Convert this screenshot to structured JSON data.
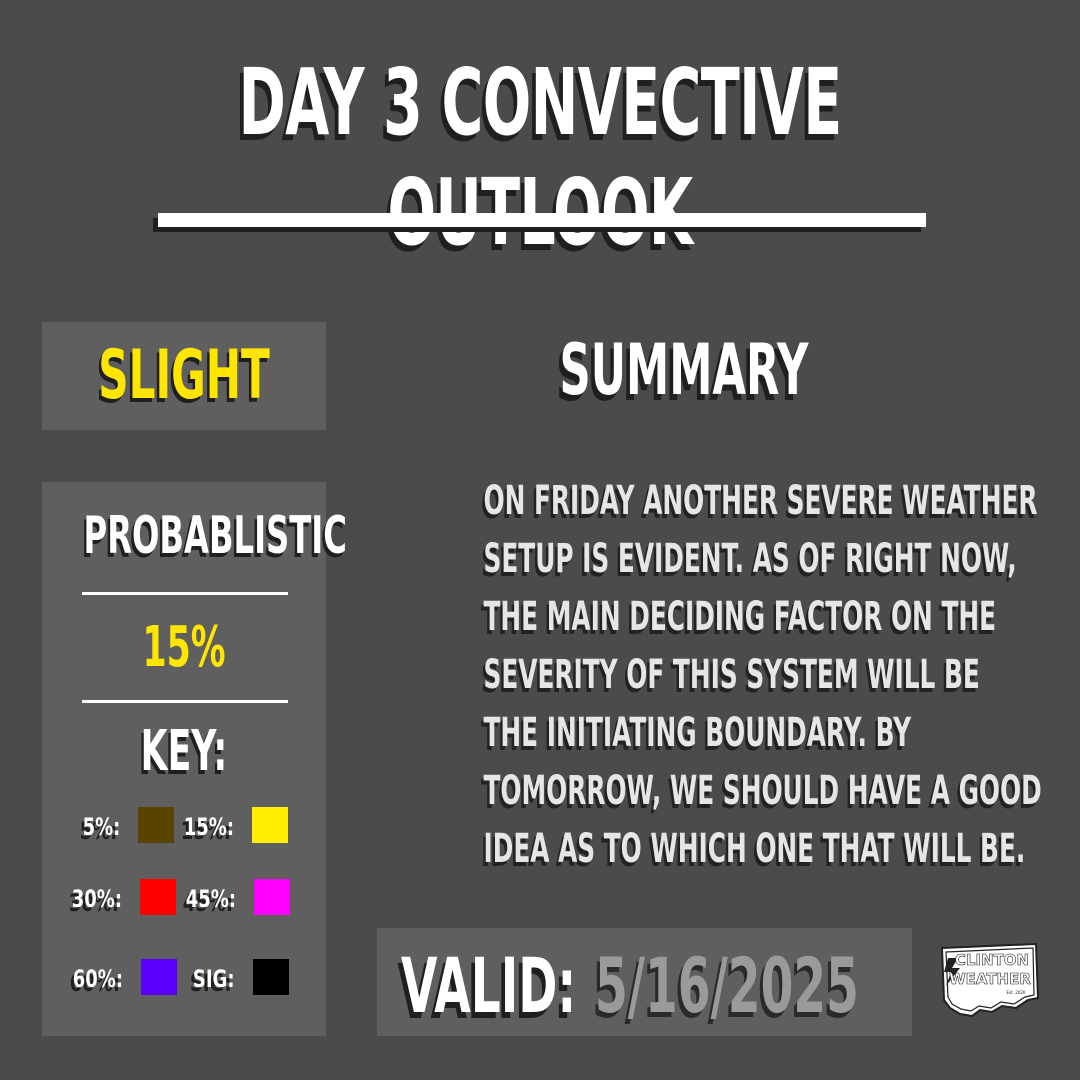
{
  "title": "DAY 3 CONVECTIVE OUTLOOK",
  "risk": {
    "label": "SLIGHT",
    "color": "#ffe600"
  },
  "probabilistic": {
    "title": "PROBABLISTIC",
    "value": "15%",
    "key_title": "KEY:",
    "key": [
      {
        "label": "5%:",
        "color": "#5a4200"
      },
      {
        "label": "15%:",
        "color": "#ffee00"
      },
      {
        "label": "30%:",
        "color": "#ff0000"
      },
      {
        "label": "45%:",
        "color": "#ff00ff"
      },
      {
        "label": "60%:",
        "color": "#5b00ff"
      },
      {
        "label": "SIG:",
        "color": "#000000"
      }
    ]
  },
  "summary": {
    "title": "SUMMARY",
    "lines": [
      "ON FRIDAY ANOTHER SEVERE WEATHER",
      "SETUP IS EVIDENT. AS OF RIGHT NOW,",
      "THE MAIN DECIDING FACTOR ON THE",
      "SEVERITY OF THIS SYSTEM WILL BE",
      "THE INITIATING BOUNDARY. BY",
      "TOMORROW, WE SHOULD HAVE A GOOD",
      "IDEA AS TO WHICH ONE THAT WILL BE."
    ]
  },
  "valid": {
    "label": "VALID:",
    "date": "5/16/2025"
  },
  "logo": {
    "line1": "CLINTON",
    "line2": "WEATHER",
    "est": "Est. 2020",
    "icon": "lightning-bolt-icon"
  },
  "colors": {
    "background": "#4b4b4b",
    "panel": "#5f5f5f",
    "accent": "#ffe600",
    "text": "#ffffff"
  }
}
